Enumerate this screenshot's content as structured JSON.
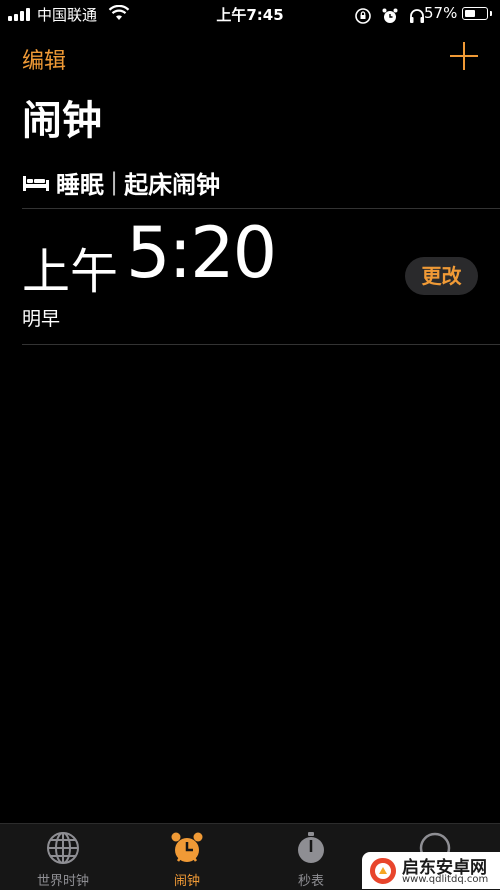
{
  "status_bar": {
    "carrier": "中国联通",
    "time": "上午7:45",
    "battery_pct": "57%",
    "battery_level": 0.57,
    "icons": [
      "signal-icon",
      "wifi-icon",
      "orientation-lock-icon",
      "alarm-icon",
      "headphones-icon",
      "battery-icon"
    ]
  },
  "header": {
    "edit_label": "编辑",
    "add_icon": "plus-icon",
    "title": "闹钟"
  },
  "sleep": {
    "icon": "bed-icon",
    "label": "睡眠",
    "separator": "|",
    "subtitle": "起床闹钟"
  },
  "alarm": {
    "period": "上午",
    "time": "5:20",
    "label": "明早",
    "change_label": "更改"
  },
  "tabbar": {
    "tabs": [
      {
        "label": "世界时钟",
        "icon": "globe-icon",
        "active": false
      },
      {
        "label": "闹钟",
        "icon": "alarm-clock-icon",
        "active": true
      },
      {
        "label": "秒表",
        "icon": "stopwatch-icon",
        "active": false
      },
      {
        "label": "",
        "icon": "timer-icon",
        "active": false
      }
    ]
  },
  "watermark": {
    "name": "启东安卓网",
    "url": "www.qdlitdq.com"
  },
  "colors": {
    "accent": "#f09a36",
    "background": "#000000",
    "tab_inactive": "#8e8e93"
  }
}
